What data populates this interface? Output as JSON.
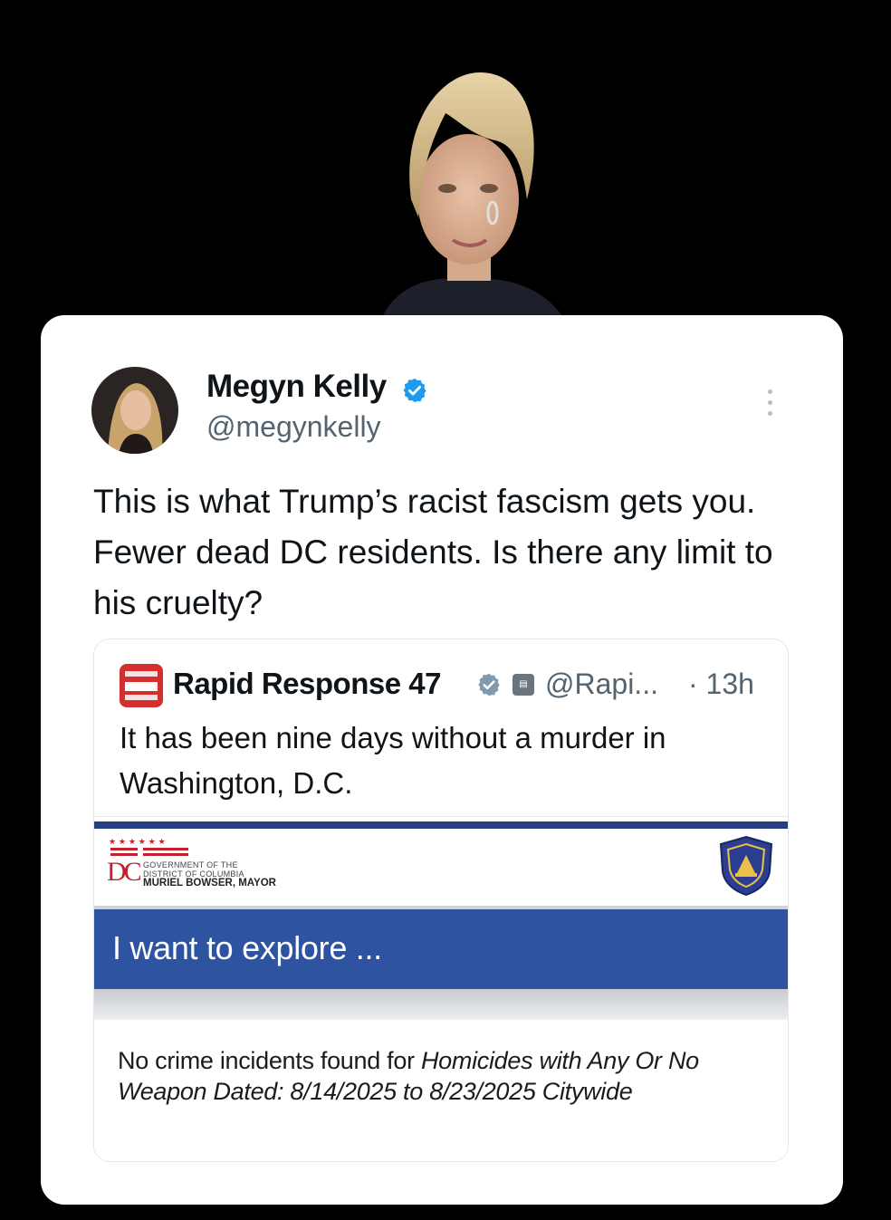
{
  "tweet": {
    "author_name": "Megyn Kelly",
    "author_handle": "@megynkelly",
    "text": "This is what Trump’s racist fascism gets you. Fewer dead DC residents. Is there any limit to his cruelty?"
  },
  "quoted_tweet": {
    "author_name": "Rapid Response 47",
    "author_handle": "@Rapi...",
    "time": "· 13h",
    "text": "It has been nine days without a murder in Washington, D.C.",
    "media": {
      "gov_line1": "GOVERNMENT OF THE",
      "gov_line2": "DISTRICT OF COLUMBIA",
      "mayor": "MURIEL BOWSER, MAYOR",
      "dc_letters": "DC",
      "explore_label": "I want to explore ...",
      "result_prefix": "No crime incidents found for ",
      "result_query": "Homicides with Any Or No Weapon Dated: 8/14/2025 to 8/23/2025 Citywide"
    }
  },
  "colors": {
    "verified_blue": "#1d9bf0",
    "explore_blue": "#2e53a1",
    "dc_red": "#c3202d"
  },
  "icons": {
    "verified": "verified-badge-icon",
    "gov_affiliation": "government-affiliation-icon",
    "more": "more-options-icon",
    "police": "police-badge-icon"
  }
}
